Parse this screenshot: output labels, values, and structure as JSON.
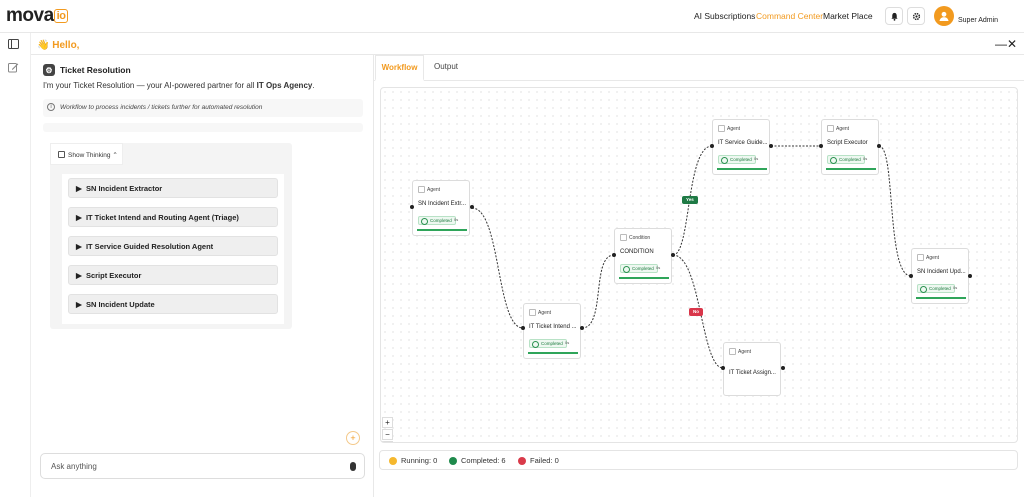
{
  "app": {
    "logo_main": "mova",
    "logo_suffix": "io",
    "greeting": "👋 Hello,"
  },
  "nav": [
    {
      "label": "AI Subscriptions",
      "active": false
    },
    {
      "label": "Command Center",
      "active": true
    },
    {
      "label": "Market Place",
      "active": false
    }
  ],
  "header_icons": [
    "bell-icon",
    "gear-icon"
  ],
  "user": {
    "name": "Super Admin",
    "avatar_icon": "user-avatar-icon"
  },
  "rail_icons": [
    "sidebar-toggle-icon",
    "edit-icon"
  ],
  "window_controls": {
    "minimize": "—",
    "close": "✕"
  },
  "chat": {
    "agent_title": "Ticket Resolution",
    "intro_prefix": "I'm your Ticket Resolution — your AI-powered partner for all ",
    "intro_bold": "IT Ops Agency",
    "intro_suffix": ".",
    "note": "Workflow to process incidents / tickets further for automated resolution",
    "thinking_label": "Show Thinking",
    "steps": [
      "SN Incident Extractor",
      "IT Ticket Intend and Routing Agent (Triage)",
      "IT Service Guided Resolution Agent",
      "Script Executor",
      "SN Incident Update"
    ],
    "input_placeholder": "Ask anything"
  },
  "tabs": [
    {
      "label": "Workflow",
      "active": true
    },
    {
      "label": "Output",
      "active": false
    }
  ],
  "workflow": {
    "nodes": [
      {
        "id": "n1",
        "type": "Agent",
        "title": "SN Incident Extr...",
        "status": "Completed",
        "duration": "0s"
      },
      {
        "id": "n2",
        "type": "Agent",
        "title": "IT Ticket Intend ...",
        "status": "Completed",
        "duration": "0s"
      },
      {
        "id": "n3",
        "type": "Condition",
        "title": "CONDITION",
        "status": "Completed",
        "duration": "0s"
      },
      {
        "id": "n4",
        "type": "Agent",
        "title": "IT Service Guide...",
        "status": "Completed",
        "duration": "0s"
      },
      {
        "id": "n5",
        "type": "Agent",
        "title": "Script Executor",
        "status": "Completed",
        "duration": "0s"
      },
      {
        "id": "n6",
        "type": "Agent",
        "title": "SN Incident Upd...",
        "status": "Completed",
        "duration": "0s"
      },
      {
        "id": "n7",
        "type": "Agent",
        "title": "IT Ticket Assign...",
        "status": "",
        "duration": ""
      }
    ],
    "edge_labels": {
      "yes": "Yes",
      "no": "No"
    },
    "zoom_controls": [
      "+",
      "−",
      "⛶"
    ]
  },
  "legend": {
    "running": {
      "label": "Running: 0",
      "color": "#f5b82e"
    },
    "completed": {
      "label": "Completed: 6",
      "color": "#1f8a4c"
    },
    "failed": {
      "label": "Failed: 0",
      "color": "#d93a4a"
    }
  }
}
